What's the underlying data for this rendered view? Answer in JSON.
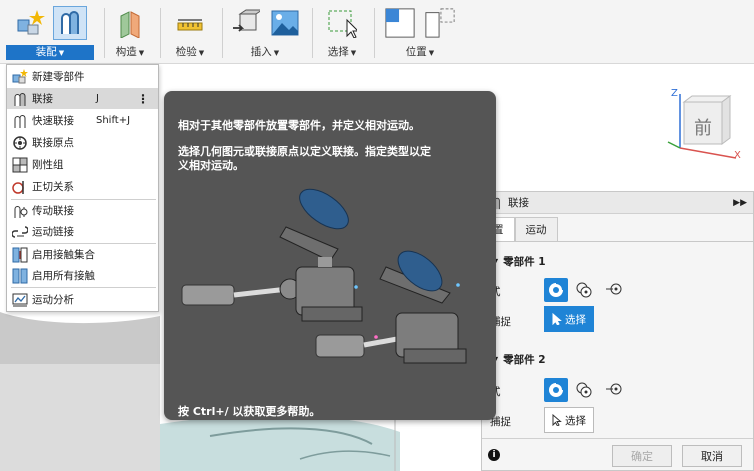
{
  "toolbar": {
    "groups": [
      {
        "label": "装配",
        "active": true
      },
      {
        "label": "构造"
      },
      {
        "label": "检验"
      },
      {
        "label": "插入"
      },
      {
        "label": "选择"
      },
      {
        "label": "位置"
      }
    ],
    "accent_color": "#1e74c8"
  },
  "menu": {
    "items": [
      {
        "label": "新建零部件",
        "shortcut": "",
        "icon": "new-component-icon"
      },
      {
        "label": "联接",
        "shortcut": "J",
        "icon": "joint-icon",
        "highlighted": true
      },
      {
        "label": "快速联接",
        "shortcut": "Shift+J",
        "icon": "as-built-joint-icon"
      },
      {
        "label": "联接原点",
        "shortcut": "",
        "icon": "joint-origin-icon"
      },
      {
        "label": "刚性组",
        "shortcut": "",
        "icon": "rigid-group-icon"
      },
      {
        "label": "正切关系",
        "shortcut": "",
        "icon": "tangent-relationship-icon"
      },
      {
        "label": "传动联接",
        "shortcut": "",
        "icon": "drive-joints-icon"
      },
      {
        "label": "运动链接",
        "shortcut": "",
        "icon": "motion-link-icon"
      },
      {
        "label": "启用接触集合",
        "shortcut": "",
        "icon": "enable-contact-sets-icon"
      },
      {
        "label": "启用所有接触",
        "shortcut": "",
        "icon": "enable-all-contact-icon"
      },
      {
        "label": "运动分析",
        "shortcut": "",
        "icon": "motion-study-icon"
      }
    ]
  },
  "tooltip": {
    "line1": "相对于其他零部件放置零部件，并定义相对运动。",
    "line2a": "选择几何图元或联接原点以定义联接。指定类型以定",
    "line2b": "义相对运动。",
    "footer": "按 Ctrl+/ 以获取更多帮助。"
  },
  "viewcube": {
    "face": "前",
    "z": "Z",
    "x": "X"
  },
  "panel": {
    "title": "联接",
    "tabs": [
      "置",
      "运动"
    ],
    "section1": "零部件 1",
    "section2": "零部件 2",
    "mode_label": "式",
    "snap_label": "捕捉",
    "select_label": "选择",
    "ok": "确定",
    "cancel": "取消"
  }
}
